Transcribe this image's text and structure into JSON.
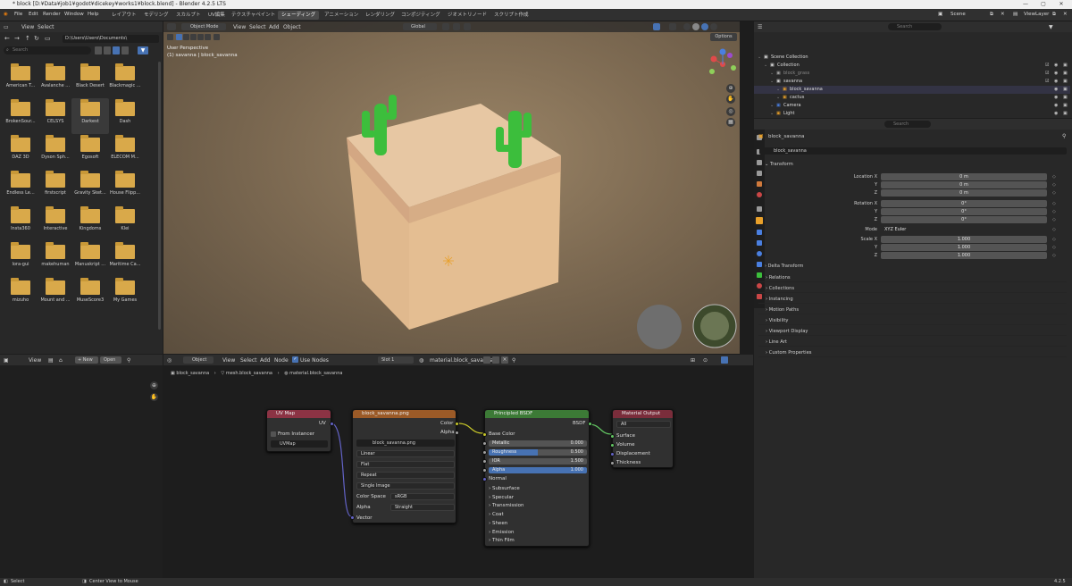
{
  "window": {
    "title": "* block [D:¥Data¥job1¥godot¥dicekey¥works1¥block.blend] - Blender 4.2.5 LTS",
    "version": "4.2.5"
  },
  "menu": [
    "File",
    "Edit",
    "Render",
    "Window",
    "Help"
  ],
  "workspaces": [
    "レイアウト",
    "モデリング",
    "スカルプト",
    "UV編集",
    "テクスチャペイント",
    "シェーディング",
    "アニメーション",
    "レンダリング",
    "コンポジティング",
    "ジオメトリノード",
    "スクリプト作成"
  ],
  "active_workspace": "シェーディング",
  "scene": {
    "label": "Scene",
    "viewlayer": "ViewLayer"
  },
  "file_browser": {
    "menu": [
      "View",
      "Select"
    ],
    "path": "D:\\Users\\Usero\\Documents\\",
    "search_placeholder": "Search",
    "items": [
      "American T...",
      "Avalanche ...",
      "Black Desert",
      "Blackmagic ...",
      "BrokenSour...",
      "CELSYS",
      "Darkest",
      "Dash",
      "DAZ 3D",
      "Dyson Sph...",
      "Egosoft",
      "ELECOM M...",
      "Endless Le...",
      "firstscript",
      "Gravity Sket...",
      "House Flipp...",
      "Insta360",
      "Interactive",
      "Kingdoms",
      "Klei",
      "lora-gui",
      "makehuman",
      "Manuskript ...",
      "Maritime Ca...",
      "mizuho",
      "Mount and ...",
      "MuseScore3",
      "My Games"
    ]
  },
  "viewport": {
    "mode": "Object Mode",
    "menu": [
      "View",
      "Select",
      "Add",
      "Object"
    ],
    "transform": "Global",
    "options": "Options",
    "perspective": "User Perspective",
    "object_info": "(1) savanna | block_savanna"
  },
  "image_editor": {
    "view": "View",
    "new": "New",
    "open": "Open"
  },
  "node_editor": {
    "type": "Object",
    "menu": [
      "View",
      "Select",
      "Add",
      "Node"
    ],
    "use_nodes": "Use Nodes",
    "slot": "Slot 1",
    "material": "material.block_savanna",
    "breadcrumb": [
      "block_savanna",
      "mesh.block_savanna",
      "material.block_savanna"
    ],
    "uvmap": {
      "title": "UV Map",
      "out": "UV",
      "from_instancer": "From Instancer",
      "map": "UVMap"
    },
    "image": {
      "title": "block_savanna.png",
      "out_color": "Color",
      "out_alpha": "Alpha",
      "file": "block_savanna.png",
      "interp": "Linear",
      "proj": "Flat",
      "ext": "Repeat",
      "source": "Single Image",
      "cs_label": "Color Space",
      "cs": "sRGB",
      "alpha_label": "Alpha",
      "alpha": "Straight",
      "vector": "Vector"
    },
    "bsdf": {
      "title": "Principled BSDF",
      "out": "BSDF",
      "base_color": "Base Color",
      "metallic": "Metallic",
      "metallic_v": "0.000",
      "roughness": "Roughness",
      "roughness_v": "0.500",
      "ior": "IOR",
      "ior_v": "1.500",
      "alpha": "Alpha",
      "alpha_v": "1.000",
      "normal": "Normal",
      "subpanels": [
        "Subsurface",
        "Specular",
        "Transmission",
        "Coat",
        "Sheen",
        "Emission",
        "Thin Film"
      ]
    },
    "output": {
      "title": "Material Output",
      "target": "All",
      "inputs": [
        "Surface",
        "Volume",
        "Displacement",
        "Thickness"
      ]
    }
  },
  "outliner": {
    "search_placeholder": "Search",
    "rows": [
      {
        "label": "Scene Collection",
        "indent": 0
      },
      {
        "label": "Collection",
        "indent": 1
      },
      {
        "label": "block_grass",
        "indent": 2
      },
      {
        "label": "savanna",
        "indent": 2
      },
      {
        "label": "block_savanna",
        "indent": 3
      },
      {
        "label": "cactus",
        "indent": 3
      },
      {
        "label": "Camera",
        "indent": 2
      },
      {
        "label": "Light",
        "indent": 2
      }
    ]
  },
  "properties": {
    "search_placeholder": "Search",
    "object": "block_savanna",
    "object_field": "block_savanna",
    "transform": "Transform",
    "location": {
      "label": "Location X",
      "x": "0 m",
      "y": "0 m",
      "z": "0 m"
    },
    "rotation": {
      "label": "Rotation X",
      "x": "0°",
      "y": "0°",
      "z": "0°"
    },
    "mode_label": "Mode",
    "mode": "XYZ Euler",
    "scale": {
      "label": "Scale X",
      "x": "1.000",
      "y": "1.000",
      "z": "1.000"
    },
    "axis": [
      "Y",
      "Z"
    ],
    "delta": "Delta Transform",
    "sections": [
      "Relations",
      "Collections",
      "Instancing",
      "Motion Paths",
      "Visibility",
      "Viewport Display",
      "Line Art",
      "Custom Properties"
    ]
  },
  "status": {
    "left": "Select",
    "middle": "Center View to Mouse",
    "right": "4.2.5"
  },
  "colors": {
    "uv_header": "#8c3344",
    "image_header": "#9b5a27",
    "bsdf_header": "#3c7a36",
    "output_header": "#7a2d3b",
    "accent": "#4772b3"
  }
}
